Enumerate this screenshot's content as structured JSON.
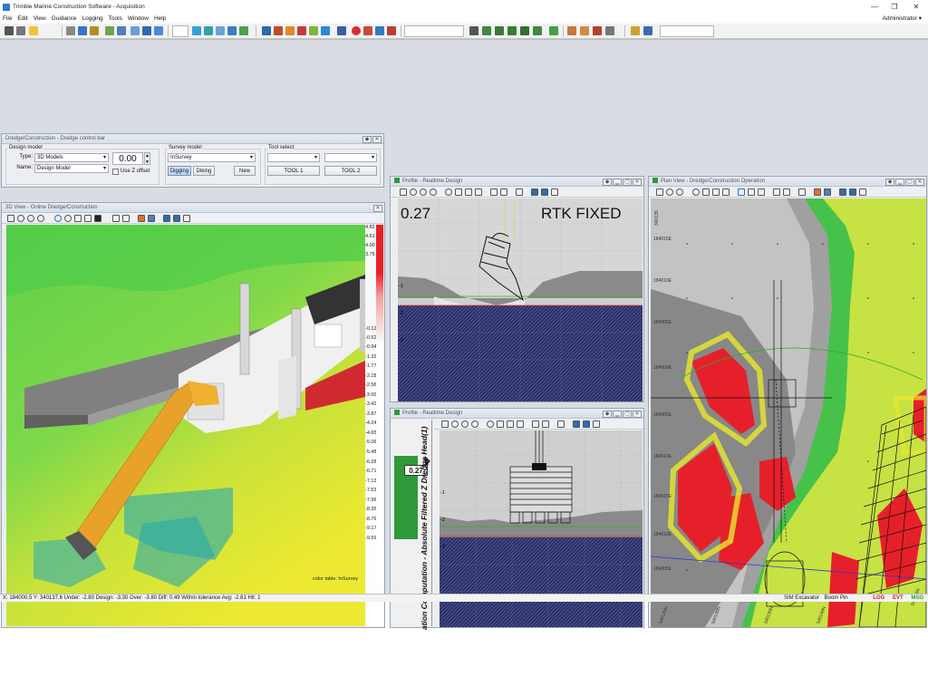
{
  "window": {
    "title": "Trimble Marine Construction Software - Acquisition",
    "controls": [
      "—",
      "❐",
      "✕"
    ]
  },
  "menu": {
    "items": [
      "File",
      "Edit",
      "View",
      "Guidance",
      "Logging",
      "Tools",
      "Window",
      "Help"
    ],
    "user": "Administrator ▾"
  },
  "dredge_control": {
    "title": "Dredge/Construction - Dredge control bar",
    "design_model_label": "Design model",
    "type_label": "Type:",
    "type_value": "3D Models",
    "name_label": "Name:",
    "name_value": "Design Model",
    "offset_value": "0.00",
    "use_z_offset": "Use Z offset",
    "survey_model_label": "Survey model",
    "survey_value": "InSurvey",
    "digging": "Digging",
    "dikking": "Diking",
    "new": "New",
    "tool_select_label": "Tool select",
    "tool1": "TOOL 1",
    "tool2": "TOOL 2"
  },
  "view3d": {
    "title": "3D View - Online Dredge/Construction",
    "color_table": "color table: InSurvey",
    "legend": [
      "4.82",
      "4.61",
      "4.00",
      "3.75",
      "-0.12",
      "-0.52",
      "-0.94",
      "-1.32",
      "-1.77",
      "-2.18",
      "-2.56",
      "-3.00",
      "-3.42",
      "-3.87",
      "-4.24",
      "-4.65",
      "-5.06",
      "-5.48",
      "-6.28",
      "-6.71",
      "-7.13",
      "-7.53",
      "-7.96",
      "-8.35",
      "-8.76",
      "-9.17",
      "-9.59"
    ]
  },
  "profile_top": {
    "title": "Profile - Realtime Design",
    "value": "0.27",
    "status": "RTK FIXED",
    "axis": [
      "-1",
      "-2",
      "-3"
    ]
  },
  "profile_bottom": {
    "title": "Profile - Realtime Design",
    "side_label": "ation Computation - Absolute Filtered Z Dredge Head(1)",
    "value": "0.27",
    "axis": [
      "-1",
      "-2",
      "-3"
    ]
  },
  "plan_view": {
    "title": "Plan View - Dredge/Construction Operation",
    "northings": [
      "184015E",
      "184010E",
      "184005E",
      "184000E",
      "184005E",
      "184010E",
      "184015E",
      "184010E",
      "184005E",
      "184000E"
    ],
    "eastings": [
      "340125N",
      "340130N",
      "340135N",
      "340140N",
      "340145N"
    ],
    "top_tick": "340135"
  },
  "status": {
    "left": "X: 184000.5   Y: 340137.6  Under: -2.80  Design: -3.30  Over: -3.80  Diff: 0.49  Within tolerance  Avg: -2.81  Hit: 1",
    "sim": "SIM Excavator",
    "boom": "Boom Pin",
    "log": "LOG",
    "evt": "EVT",
    "msg": "MSG"
  },
  "colors": {
    "accent": "#2e9a3a",
    "terrain_green": "#5fcf4a",
    "terrain_yellow": "#e8ea2a",
    "dredge_red": "#e6202a",
    "boom_orange": "#e8a22a",
    "below_grade": "#2a2f6a"
  }
}
